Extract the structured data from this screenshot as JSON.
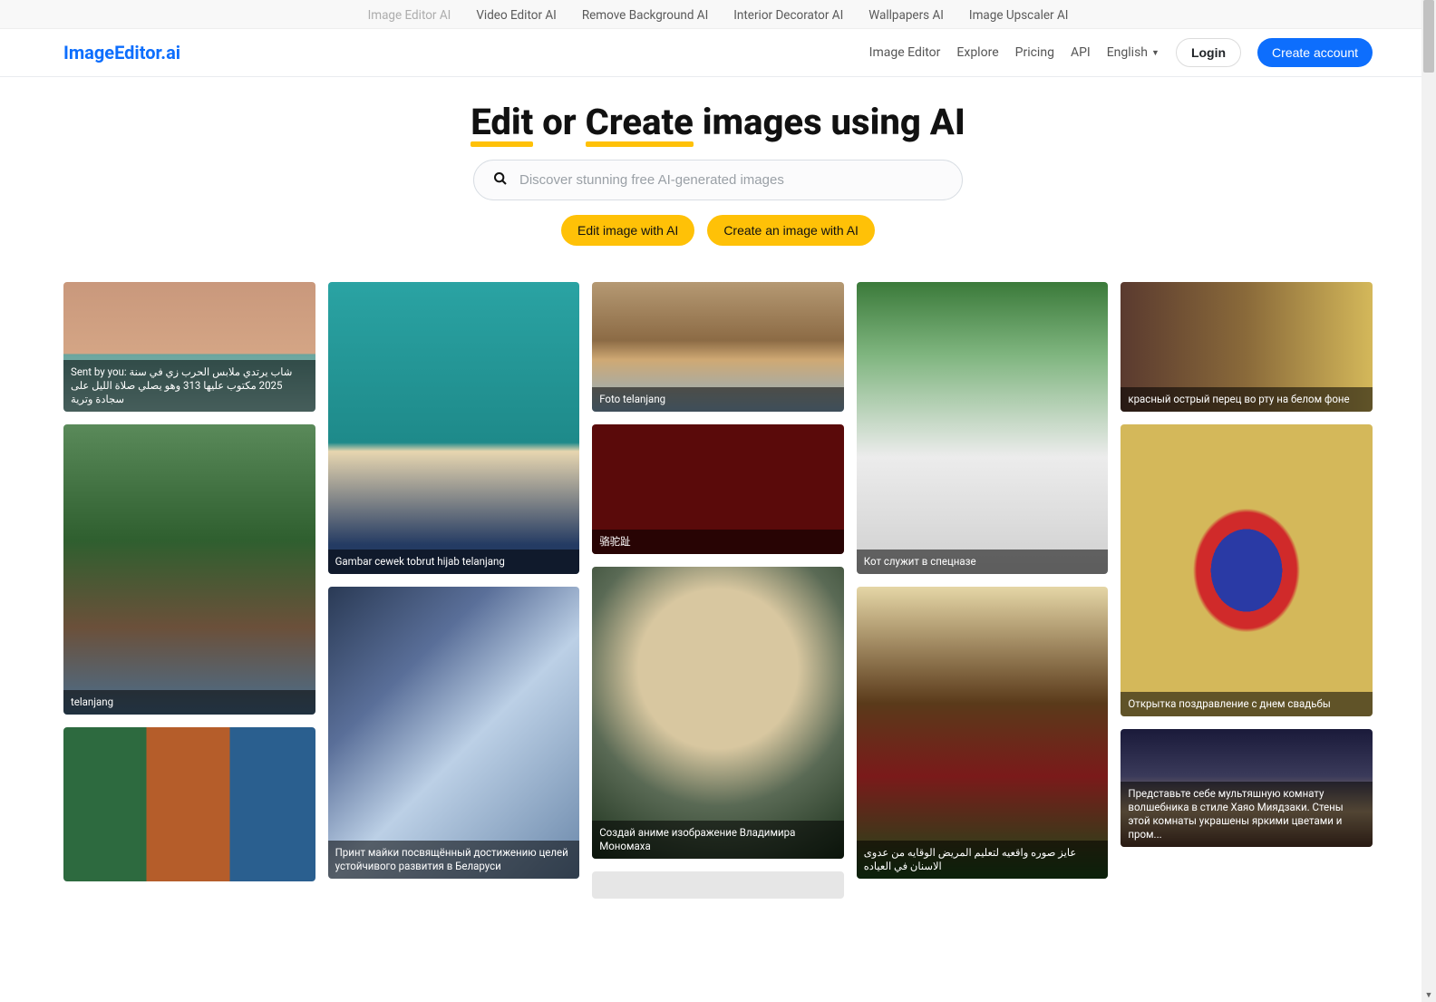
{
  "topbar": {
    "items": [
      {
        "label": "Image Editor AI",
        "muted": true
      },
      {
        "label": "Video Editor AI",
        "muted": false
      },
      {
        "label": "Remove Background AI",
        "muted": false
      },
      {
        "label": "Interior Decorator AI",
        "muted": false
      },
      {
        "label": "Wallpapers AI",
        "muted": false
      },
      {
        "label": "Image Upscaler AI",
        "muted": false
      }
    ]
  },
  "brand": "ImageEditor.ai",
  "nav": {
    "image_editor": "Image Editor",
    "explore": "Explore",
    "pricing": "Pricing",
    "api": "API",
    "language": "English",
    "login": "Login",
    "create_account": "Create account"
  },
  "hero": {
    "word1": "Edit",
    "mid1": " or ",
    "word2": "Create",
    "mid2": " images using AI"
  },
  "search": {
    "placeholder": "Discover stunning free AI-generated images"
  },
  "actions": {
    "edit": "Edit image with AI",
    "create": "Create an image with AI"
  },
  "cards": {
    "c1a": "Sent by you: شاب يرتدي ملابس الحرب زي في سنة 2025 مكتوب عليها 313 وهو يصلي صلاة الليل على سجادة وترية",
    "c1b": "telanjang",
    "c2a": "Gambar cewek tobrut hijab telanjang",
    "c2b": "Принт майки посвящённый достижению целей устойчивого развития в Беларуси",
    "c3a": "Foto telanjang",
    "c3b": "骆驼趾",
    "c3c": "Создай аниме изображение Владимира Мономаха",
    "c4a": "Кот служит в спецназе",
    "c4b": "عايز صوره واقعيه لتعليم المريض الوقايه من عدوى الاسنان في العياده",
    "c5a": "красный острый перец во рту на белом фоне",
    "c5b": "Открытка поздравление с днем свадьбы",
    "c5c": "Представьте себе мультяшную комнату волшебника в стиле Хаяо Миядзаки. Стены этой комнаты украшены яркими цветами и пром..."
  }
}
